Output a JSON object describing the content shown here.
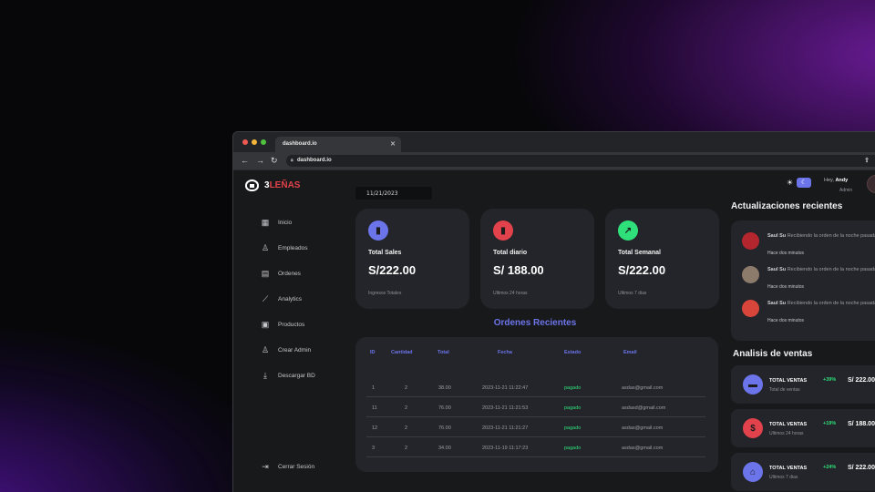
{
  "browser": {
    "tab_title": "dashboard.io",
    "url": "dashboard.io"
  },
  "brand": {
    "prefix": "3",
    "name": "LEÑAS"
  },
  "sidebar": {
    "items": [
      {
        "label": "Inicio",
        "icon": "grid-icon"
      },
      {
        "label": "Empleados",
        "icon": "user-icon"
      },
      {
        "label": "Ordenes",
        "icon": "clipboard-icon"
      },
      {
        "label": "Analytics",
        "icon": "analytics-icon"
      },
      {
        "label": "Productos",
        "icon": "box-icon"
      },
      {
        "label": "Crear Admin",
        "icon": "add-user-icon"
      },
      {
        "label": "Descargar BD",
        "icon": "download-icon"
      }
    ],
    "logout": "Cerrar Sesión"
  },
  "date": "11/21/2023",
  "header": {
    "greeting": "Hey, ",
    "user": "Andy",
    "role": "Admin"
  },
  "cards": [
    {
      "title": "Total Sales",
      "value": "S/222.00",
      "sub": "Ingresos Totales",
      "color": "#6c74ea",
      "icon": "bar-chart-icon"
    },
    {
      "title": "Total diario",
      "value": "S/ 188.00",
      "sub": "Ultimos 24 horas",
      "color": "#e2424b",
      "icon": "bar-chart-icon"
    },
    {
      "title": "Total Semanal",
      "value": "S/222.00",
      "sub": "Ultimos 7 dias",
      "color": "#2fe07a",
      "icon": "trend-icon"
    }
  ],
  "orders": {
    "title": "Ordenes Recientes",
    "headers": [
      "ID",
      "Cantidad",
      "Total",
      "Fecha",
      "Estado",
      "Email"
    ],
    "rows": [
      [
        "1",
        "2",
        "38.00",
        "2023-11-21 11:22:47",
        "pagado",
        "asdas@gmail.com"
      ],
      [
        "11",
        "2",
        "76.00",
        "2023-11-21 11:21:53",
        "pagado",
        "asdasd@gmail.com"
      ],
      [
        "12",
        "2",
        "76.00",
        "2023-11-21 11:21:27",
        "pagado",
        "asdas@gmail.com"
      ],
      [
        "3",
        "2",
        "34.00",
        "2023-11-19 11:17:23",
        "pagado",
        "asdas@gmail.com"
      ]
    ]
  },
  "updates": {
    "title": "Actualizaciones recientes",
    "items": [
      {
        "name": "Saul Su",
        "text": "Recibiendo la orden de la noche pasada",
        "time": "Hace dos minutos",
        "color": "#b3262e"
      },
      {
        "name": "Saul Su",
        "text": "Recibiendo la orden de la noche pasada",
        "time": "Hace dos minutos",
        "color": "#8c7a6a"
      },
      {
        "name": "Saul Su",
        "text": "Recibiendo la orden de la noche pasada",
        "time": "Hace dos minutos",
        "color": "#d8453a"
      }
    ]
  },
  "analysis": {
    "title": "Analisis de ventas",
    "items": [
      {
        "label": "TOTAL VENTAS",
        "sub": "Total de ventas",
        "pct": "+39%",
        "amount": "S/ 222.00",
        "color": "#6c74ea",
        "icon": "money-icon"
      },
      {
        "label": "TOTAL VENTAS",
        "sub": "Ultimos 24 horas",
        "pct": "+19%",
        "amount": "S/ 188.00",
        "color": "#e2424b",
        "icon": "dollar-icon"
      },
      {
        "label": "TOTAL VENTAS",
        "sub": "Ultimos 7 dias",
        "pct": "+24%",
        "amount": "S/ 222.00",
        "color": "#6c74ea",
        "icon": "bank-icon"
      }
    ]
  }
}
